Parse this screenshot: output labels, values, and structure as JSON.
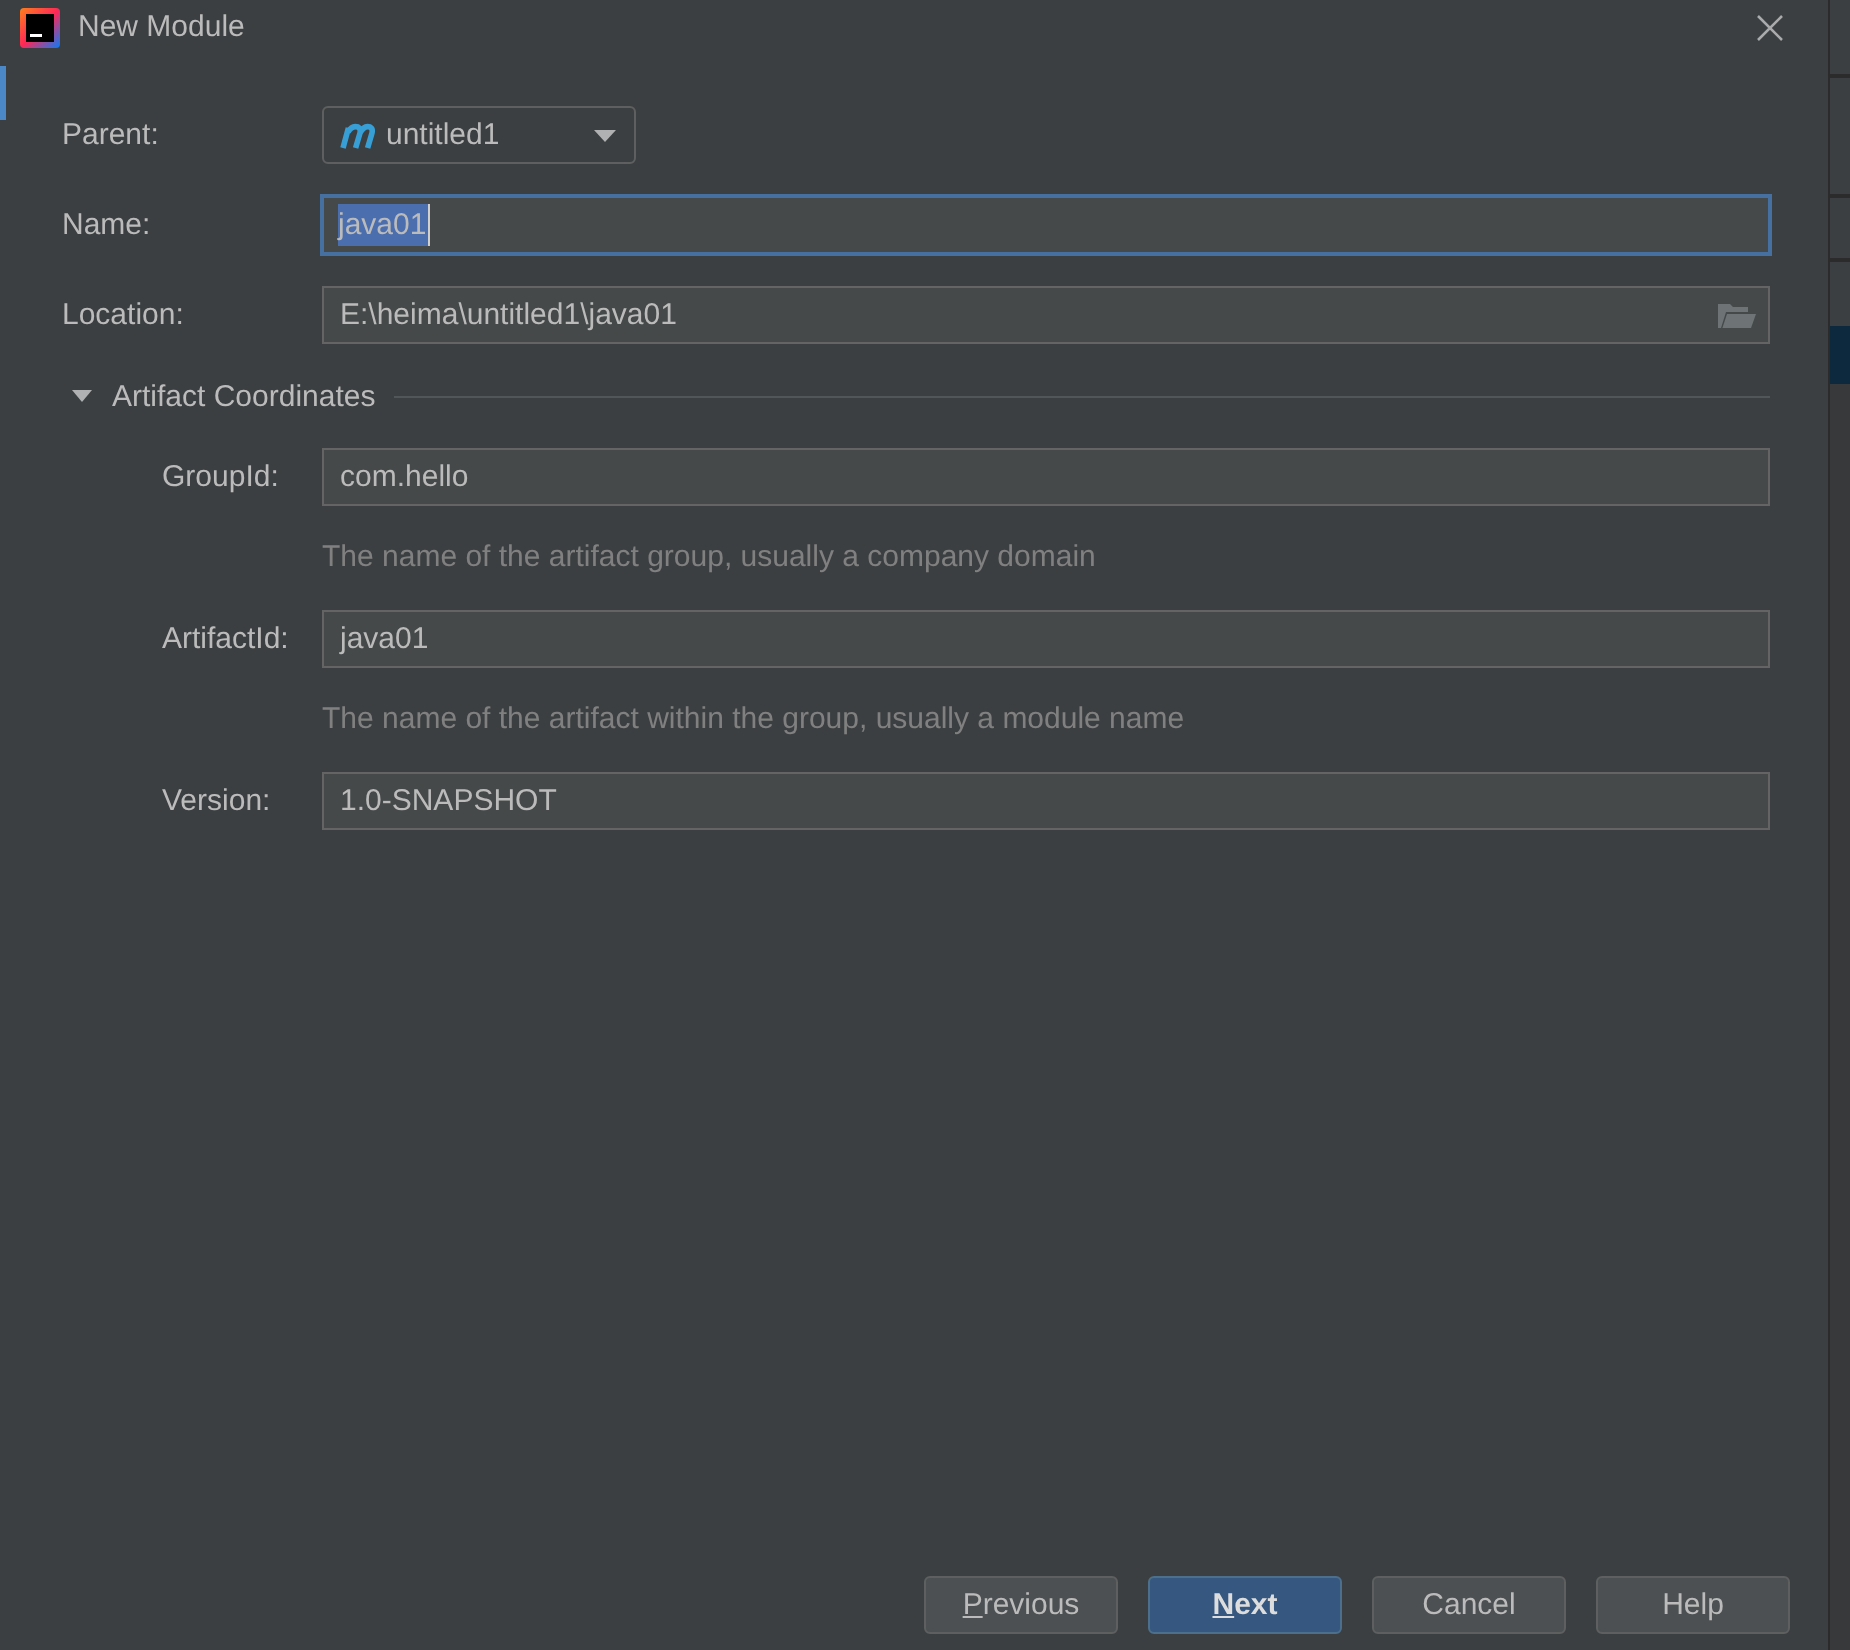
{
  "window": {
    "title": "New Module"
  },
  "form": {
    "parent": {
      "label": "Parent:",
      "value": "untitled1"
    },
    "name": {
      "label": "Name:",
      "value": "java01",
      "focused": true,
      "text_selected": true
    },
    "location": {
      "label": "Location:",
      "value": "E:\\heima\\untitled1\\java01"
    },
    "artifact_section": {
      "title": "Artifact Coordinates",
      "expanded": true,
      "fields": [
        {
          "label": "GroupId:",
          "value": "com.hello",
          "hint": "The name of the artifact group, usually a company domain"
        },
        {
          "label": "ArtifactId:",
          "value": "java01",
          "hint": "The name of the artifact within the group, usually a module name"
        },
        {
          "label": "Version:",
          "value": "1.0-SNAPSHOT"
        }
      ]
    }
  },
  "buttons": [
    {
      "label": "Previous",
      "kind": "default",
      "mnemonic": true
    },
    {
      "label": "Next",
      "kind": "primary",
      "mnemonic": true
    },
    {
      "label": "Cancel",
      "kind": "default",
      "mnemonic": false
    },
    {
      "label": "Help",
      "kind": "default",
      "mnemonic": false
    }
  ]
}
